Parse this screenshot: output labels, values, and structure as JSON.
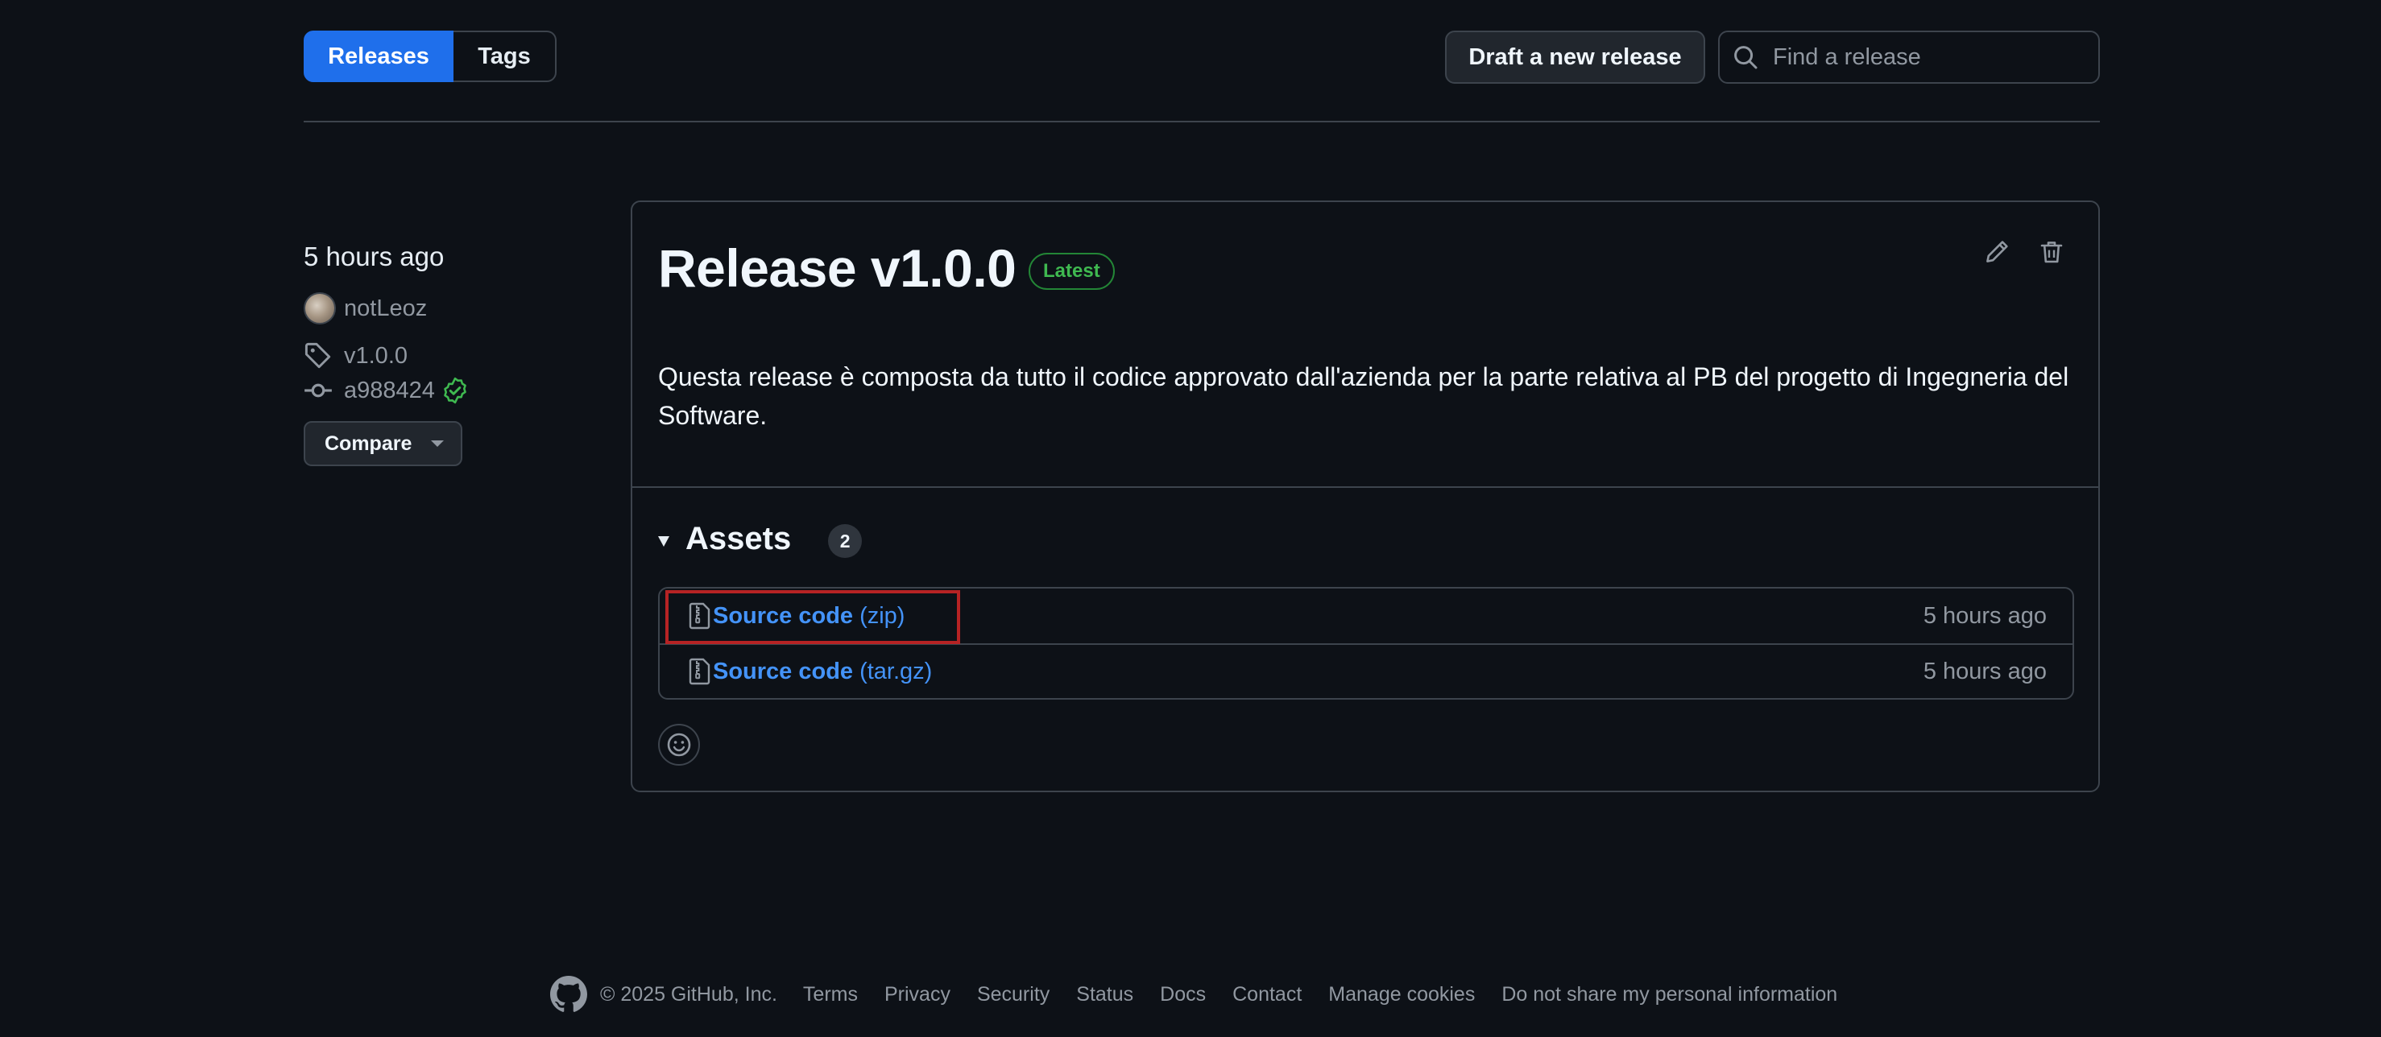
{
  "subnav": {
    "releases_label": "Releases",
    "tags_label": "Tags"
  },
  "toolbar": {
    "draft_label": "Draft a new release",
    "search_placeholder": "Find a release"
  },
  "meta": {
    "published": "5 hours ago",
    "author": "notLeoz",
    "tag": "v1.0.0",
    "commit": "a988424",
    "compare_label": "Compare"
  },
  "release": {
    "title": "Release v1.0.0",
    "badge": "Latest",
    "body": "Questa release è composta da tutto il codice approvato dall'azienda per la parte relativa al PB del progetto di Ingegneria del Software.",
    "assets_title": "Assets",
    "assets_count": "2",
    "assets": [
      {
        "name": "Source code",
        "ext": "(zip)",
        "time": "5 hours ago"
      },
      {
        "name": "Source code",
        "ext": "(tar.gz)",
        "time": "5 hours ago"
      }
    ]
  },
  "footer": {
    "copyright": "© 2025 GitHub, Inc.",
    "links": [
      "Terms",
      "Privacy",
      "Security",
      "Status",
      "Docs",
      "Contact",
      "Manage cookies",
      "Do not share my personal information"
    ]
  },
  "colors": {
    "background": "#0d1117",
    "accent": "#1f6feb",
    "link": "#4493f8",
    "success": "#3fb950",
    "highlight": "#b62324"
  }
}
